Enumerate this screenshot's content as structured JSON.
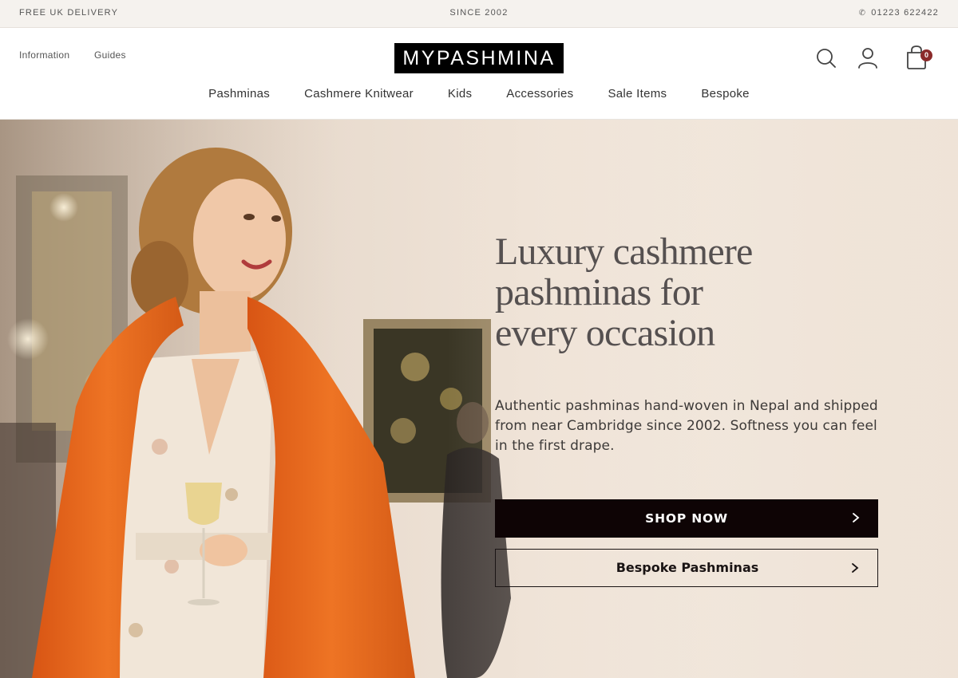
{
  "topbar": {
    "left_text": "FREE UK DELIVERY",
    "center_text": "SINCE 2002",
    "phone": "01223 622422",
    "phone_icon": "phone-icon"
  },
  "header": {
    "util_links": [
      "Information",
      "Guides"
    ],
    "logo_text": "MYPASHMINA",
    "icons": [
      "search-icon",
      "account-icon",
      "cart-icon"
    ],
    "cart_count": "0",
    "nav": [
      "Pashminas",
      "Cashmere Knitwear",
      "Kids",
      "Accessories",
      "Sale Items",
      "Bespoke"
    ]
  },
  "hero": {
    "title_lines": [
      "Luxury cashmere",
      "pashminas for",
      "every occasion"
    ],
    "subtitle": "Authentic pashminas hand-woven in Nepal and shipped from near Cambridge since 2002. Softness you can feel in the first drape.",
    "primary_button": "SHOP NOW",
    "secondary_button": "Bespoke Pashminas",
    "image_description_colors": {
      "shawl": "#e2651c",
      "dress": "#f1e6d8",
      "hair": "#b07a3e",
      "skin": "#f0c8a8"
    }
  },
  "colors": {
    "topbar_bg": "#f5f2ee",
    "logo_bg": "#000000",
    "primary_button_bg": "#0e0405",
    "cart_badge": "#8b2a2a",
    "title_text": "#555050"
  }
}
